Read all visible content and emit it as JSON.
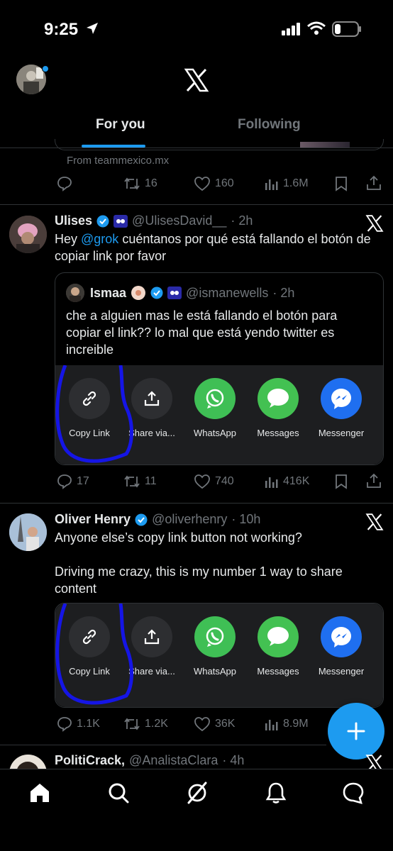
{
  "status_bar": {
    "time": "9:25"
  },
  "header": {
    "tabs": [
      {
        "label": "For you",
        "active": true
      },
      {
        "label": "Following",
        "active": false
      }
    ]
  },
  "partial_tweet": {
    "source": "From teammexico.mx",
    "actions": {
      "retweets": "16",
      "likes": "160",
      "views": "1.6M"
    }
  },
  "tweets": [
    {
      "name": "Ulises",
      "handle": "@UlisesDavid__",
      "time": "· 2h",
      "text_pre": "Hey ",
      "mention": "@grok",
      "text_post": " cuéntanos por qué está fallando el botón de copiar link por favor",
      "quote": {
        "name": "Ismaa",
        "handle": "@ismanewells",
        "time": "· 2h",
        "text": "che a alguien mas le está fallando el botón para copiar el link?? lo mal que está yendo twitter es increible"
      },
      "share_options": [
        "Copy Link",
        "Share via...",
        "WhatsApp",
        "Messages",
        "Messenger"
      ],
      "actions": {
        "replies": "17",
        "retweets": "11",
        "likes": "740",
        "views": "416K"
      }
    },
    {
      "name": "Oliver Henry",
      "handle": "@oliverhenry",
      "time": "· 10h",
      "text_line1": "Anyone else’s copy link button not working?",
      "text_line2": "Driving me crazy, this is my number 1 way to share content",
      "share_options": [
        "Copy Link",
        "Share via...",
        "WhatsApp",
        "Messages",
        "Messenger"
      ],
      "actions": {
        "replies": "1.1K",
        "retweets": "1.2K",
        "likes": "36K",
        "views": "8.9M"
      }
    },
    {
      "name": "PolitiCrack,",
      "handle": "@AnalistaClara",
      "time": "· 4h"
    }
  ],
  "colors": {
    "background": "#000000",
    "accent": "#1d9bf0",
    "whatsapp": "#3fbf55",
    "messages": "#43c152",
    "messenger": "#1f6ff0"
  }
}
